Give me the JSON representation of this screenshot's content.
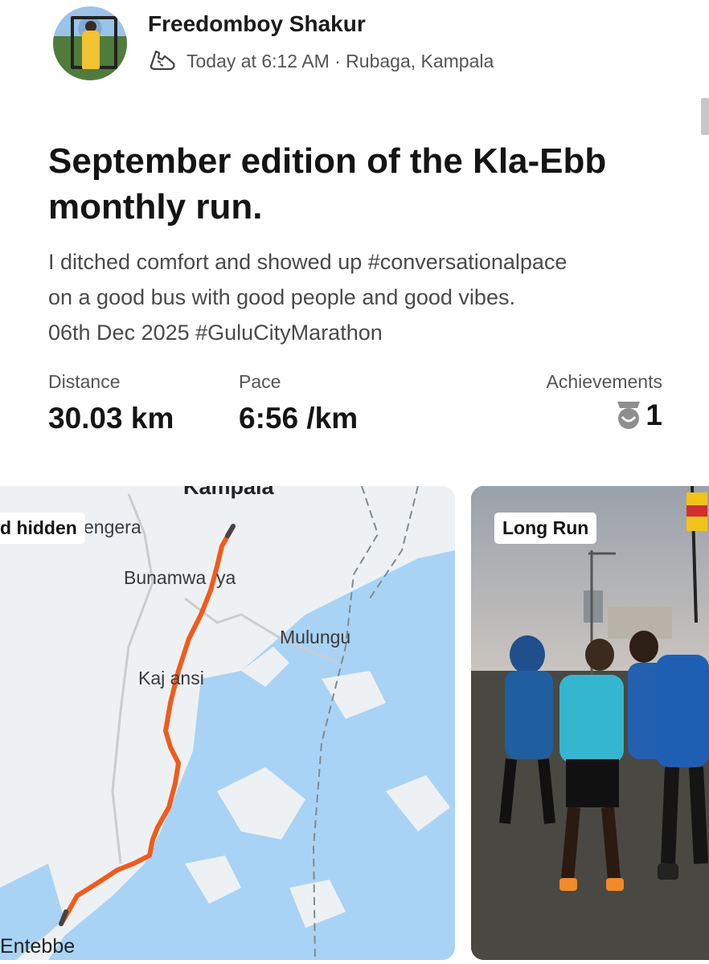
{
  "post": {
    "athlete_name": "Freedomboy Shakur",
    "meta": "Today at 6:12 AM · Rubaga, Kampala",
    "title": "September edition of the Kla-Ebb monthly run.",
    "description": "I ditched comfort and showed up #conversationalpace\non a good bus with good people and good vibes.\n06th Dec 2025 #GuluCityMarathon"
  },
  "stats": {
    "distance_label": "Distance",
    "distance_value": "30.03 km",
    "pace_label": "Pace",
    "pace_value": "6:56 /km",
    "achievements_label": "Achievements",
    "achievements_value": "1"
  },
  "map": {
    "hidden_badge": "d hidden",
    "places": {
      "kampala": "Kampala",
      "engera": "engera",
      "bunamwaya": "Bunamwa  ya",
      "mulungu": "Mulungu",
      "kajjansi": "Kaj ansi",
      "entebbe": "Entebbe"
    }
  },
  "photo": {
    "tag": "Long Run"
  },
  "colors": {
    "route": "#f15b1c",
    "water": "#a9d3f5",
    "land": "#eef1f3"
  },
  "icons": {
    "activity": "running-shoe-icon",
    "achievements": "medal-icon"
  }
}
